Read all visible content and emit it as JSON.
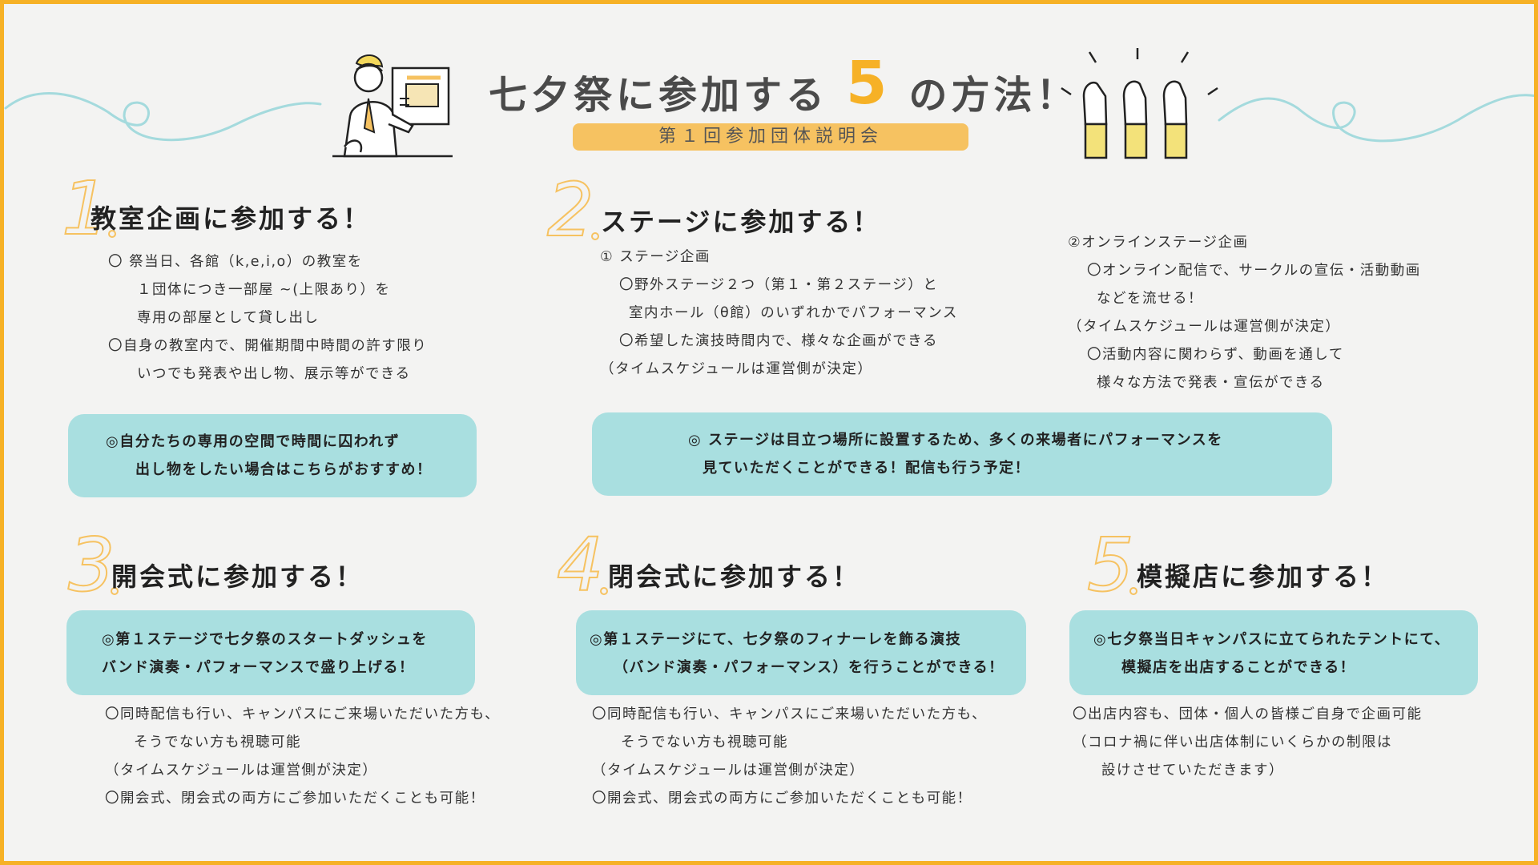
{
  "header": {
    "title_pre": "七夕祭に参加する",
    "title_num": "5",
    "title_post": "の方法！",
    "subtitle": "第１回参加団体説明会"
  },
  "sections": [
    {
      "num": "1",
      "title": "教室企画に参加する！",
      "lines": [
        "〇 祭当日、各館（k,e,i,o）の教室を",
        "１団体につき一部屋 ~(上限あり）を",
        "専用の部屋として貸し出し",
        "〇自身の教室内で、開催期間中時間の許す限り",
        "いつでも発表や出し物、展示等ができる"
      ],
      "box": [
        "◎自分たちの専用の空間で時間に囚われず",
        "出し物をしたい場合はこちらがおすすめ！"
      ]
    },
    {
      "num": "2",
      "title": "ステージに参加する！",
      "left_lines": [
        "① ステージ企画",
        "〇野外ステージ２つ（第１・第２ステージ）と",
        "室内ホール（θ館）のいずれかでパフォーマンス",
        "〇希望した演技時間内で、様々な企画ができる",
        "（タイムスケジュールは運営側が決定）"
      ],
      "right_lines": [
        "②オンラインステージ企画",
        "〇オンライン配信で、サークルの宣伝・活動動画",
        "などを流せる！",
        "（タイムスケジュールは運営側が決定）",
        "〇活動内容に関わらず、動画を通して",
        "様々な方法で発表・宣伝ができる"
      ],
      "box": [
        "◎ ステージは目立つ場所に設置するため、多くの来場者にパフォーマンスを",
        "見ていただくことができる！配信も行う予定！"
      ]
    },
    {
      "num": "3",
      "title": "開会式に参加する！",
      "box": [
        "◎第１ステージで七夕祭のスタートダッシュを",
        "バンド演奏・パフォーマンスで盛り上げる！"
      ],
      "lines": [
        "〇同時配信も行い、キャンパスにご来場いただいた方も、",
        "そうでない方も視聴可能",
        "（タイムスケジュールは運営側が決定）",
        "〇開会式、閉会式の両方にご参加いただくことも可能！"
      ]
    },
    {
      "num": "4",
      "title": "閉会式に参加する！",
      "box": [
        "◎第１ステージにて、七夕祭のフィナーレを飾る演技",
        "（バンド演奏・パフォーマンス）を行うことができる！"
      ],
      "lines": [
        "〇同時配信も行い、キャンパスにご来場いただいた方も、",
        "そうでない方も視聴可能",
        "（タイムスケジュールは運営側が決定）",
        "〇開会式、閉会式の両方にご参加いただくことも可能！"
      ]
    },
    {
      "num": "5",
      "title": "模擬店に参加する！",
      "box": [
        "◎七夕祭当日キャンパスに立てられたテントにて、",
        "模擬店を出店することができる！"
      ],
      "lines": [
        "〇出店内容も、団体・個人の皆様ご自身で企画可能",
        "（コロナ禍に伴い出店体制にいくらかの制限は",
        "設けさせていただきます）"
      ]
    }
  ],
  "colors": {
    "border": "#f6b126",
    "accent": "#f6c261",
    "box": "#a9dfe0",
    "wave": "#a4dadd",
    "background": "#f3f3f2"
  },
  "icons": [
    "presenter-illustration",
    "raised-hands-illustration",
    "wave-decoration"
  ]
}
